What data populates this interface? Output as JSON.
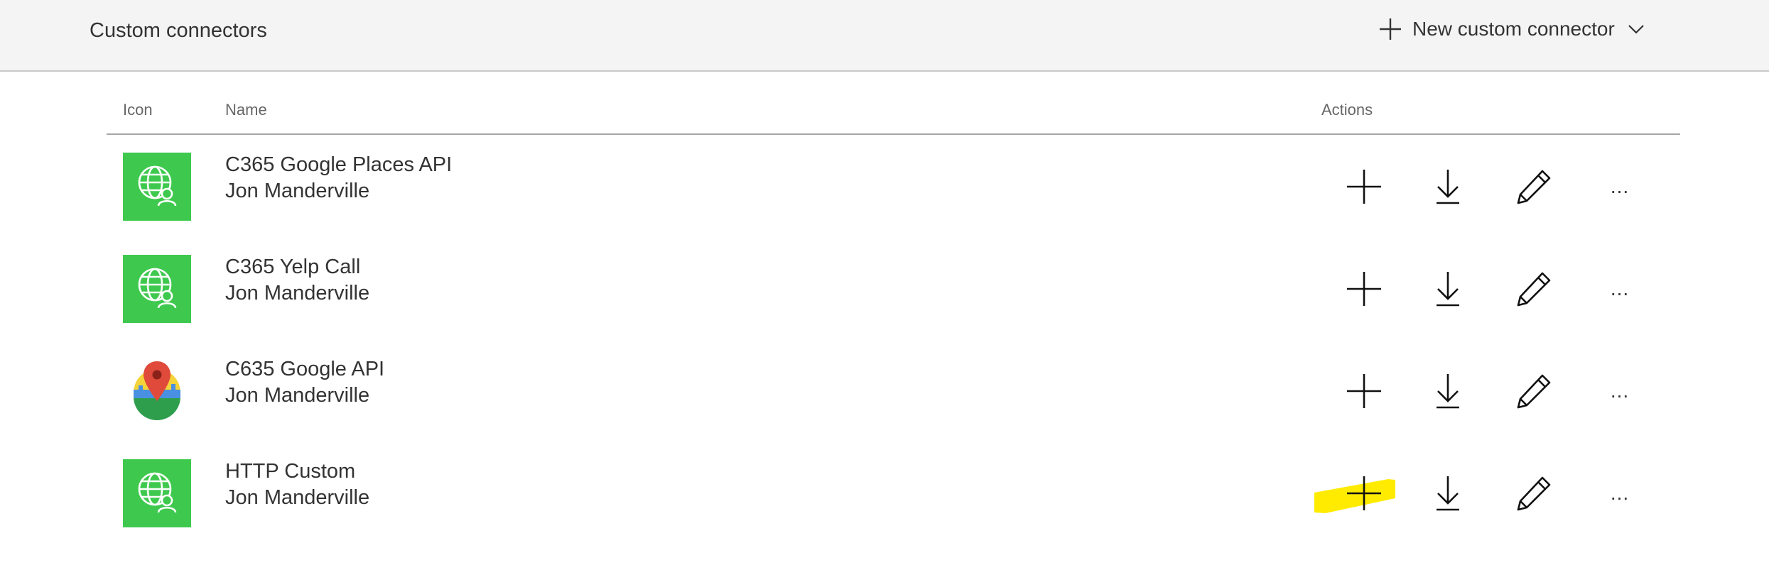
{
  "header": {
    "title": "Custom connectors",
    "new_button_label": "New custom connector",
    "new_button_icon": "plus-icon",
    "dropdown_icon": "chevron-down-icon"
  },
  "table": {
    "columns": {
      "icon": "Icon",
      "name": "Name",
      "actions": "Actions"
    },
    "rows": [
      {
        "name": "C365 Google Places API",
        "owner": "Jon Manderville",
        "icon": "globe-user-icon"
      },
      {
        "name": "C365 Yelp Call",
        "owner": "Jon Manderville",
        "icon": "globe-user-icon"
      },
      {
        "name": "C635 Google API",
        "owner": "Jon Manderville",
        "icon": "map-pin-icon"
      },
      {
        "name": "HTTP Custom",
        "owner": "Jon Manderville",
        "icon": "globe-user-icon"
      }
    ],
    "actions": [
      "add-icon",
      "download-icon",
      "edit-icon",
      "more-icon"
    ],
    "more_label": "..."
  },
  "colors": {
    "connector_green": "#3ec94e",
    "highlight_yellow": "#ffeb00",
    "header_bg": "#f4f4f4"
  }
}
